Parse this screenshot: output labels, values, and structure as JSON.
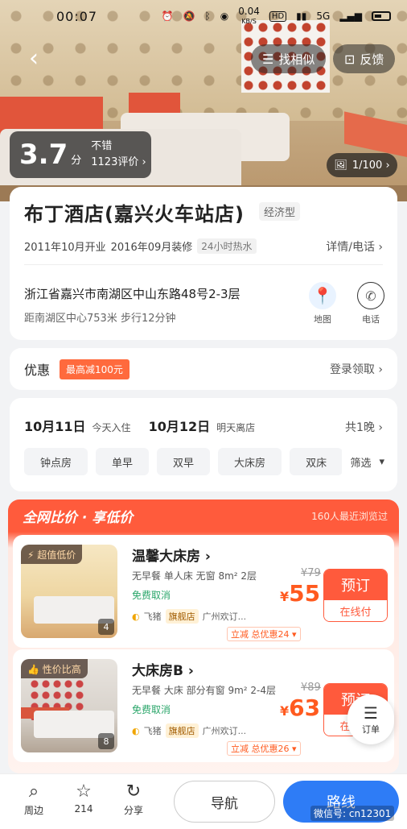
{
  "status_bar": {
    "time": "00:07",
    "speed": "0.04",
    "speed_unit": "KB/S",
    "hd": "HD",
    "network": "5G"
  },
  "header": {
    "similar_label": "找相似",
    "feedback_label": "反馈"
  },
  "rating": {
    "score": "3.7",
    "unit": "分",
    "label": "不错",
    "reviews": "1123评价 ›"
  },
  "photos": {
    "count": "1/100 ›"
  },
  "hotel": {
    "name": "布丁酒店(嘉兴火车站店)",
    "type": "经济型",
    "opened": "2011年10月开业",
    "renovated": "2016年09月装修",
    "hot_water": "24小时热水",
    "detail_link": "详情/电话 ›",
    "address": "浙江省嘉兴市南湖区中山东路48号2-3层",
    "distance": "距南湖区中心753米  步行12分钟",
    "map_label": "地图",
    "phone_label": "电话"
  },
  "promo": {
    "label": "优惠",
    "tag": "最高减100元",
    "link": "登录领取 ›"
  },
  "dates": {
    "checkin": "10月11日",
    "checkin_sub": "今天入住",
    "checkout": "10月12日",
    "checkout_sub": "明天离店",
    "nights": "共1晚 ›",
    "chips": [
      "钟点房",
      "单早",
      "双早",
      "大床房",
      "双床"
    ],
    "filter_label": "筛选"
  },
  "compare": {
    "title": "全网比价 · 享低价",
    "viewed": "160人最近浏览过"
  },
  "rooms": [
    {
      "badge": "⚡ 超值低价",
      "img_count": "4",
      "name": "温馨大床房 ›",
      "specs": "无早餐  单人床  无窗  8m²  2层",
      "cancel": "免费取消",
      "seller": "飞猪",
      "flagship": "旗舰店",
      "shop": "广州欢订...",
      "old_price": "¥79",
      "currency": "¥",
      "price": "55",
      "discount": "立减  总优惠24 ▾",
      "book_label": "预订",
      "pay_label": "在线付"
    },
    {
      "badge": "👍 性价比高",
      "img_count": "8",
      "name": "大床房B ›",
      "specs": "无早餐  大床  部分有窗  9m²  2-4层",
      "cancel": "免费取消",
      "seller": "飞猪",
      "flagship": "旗舰店",
      "shop": "广州欢订...",
      "old_price": "¥89",
      "currency": "¥",
      "price": "63",
      "discount": "立减  总优惠26 ▾",
      "book_label": "预订",
      "pay_label": "在线付"
    }
  ],
  "order_fab": {
    "label": "订单"
  },
  "bottom": {
    "nearby": "周边",
    "fav_count": "214",
    "share": "分享",
    "navigate": "导航",
    "route": "路线"
  },
  "watermark": "微信号: cn12301"
}
